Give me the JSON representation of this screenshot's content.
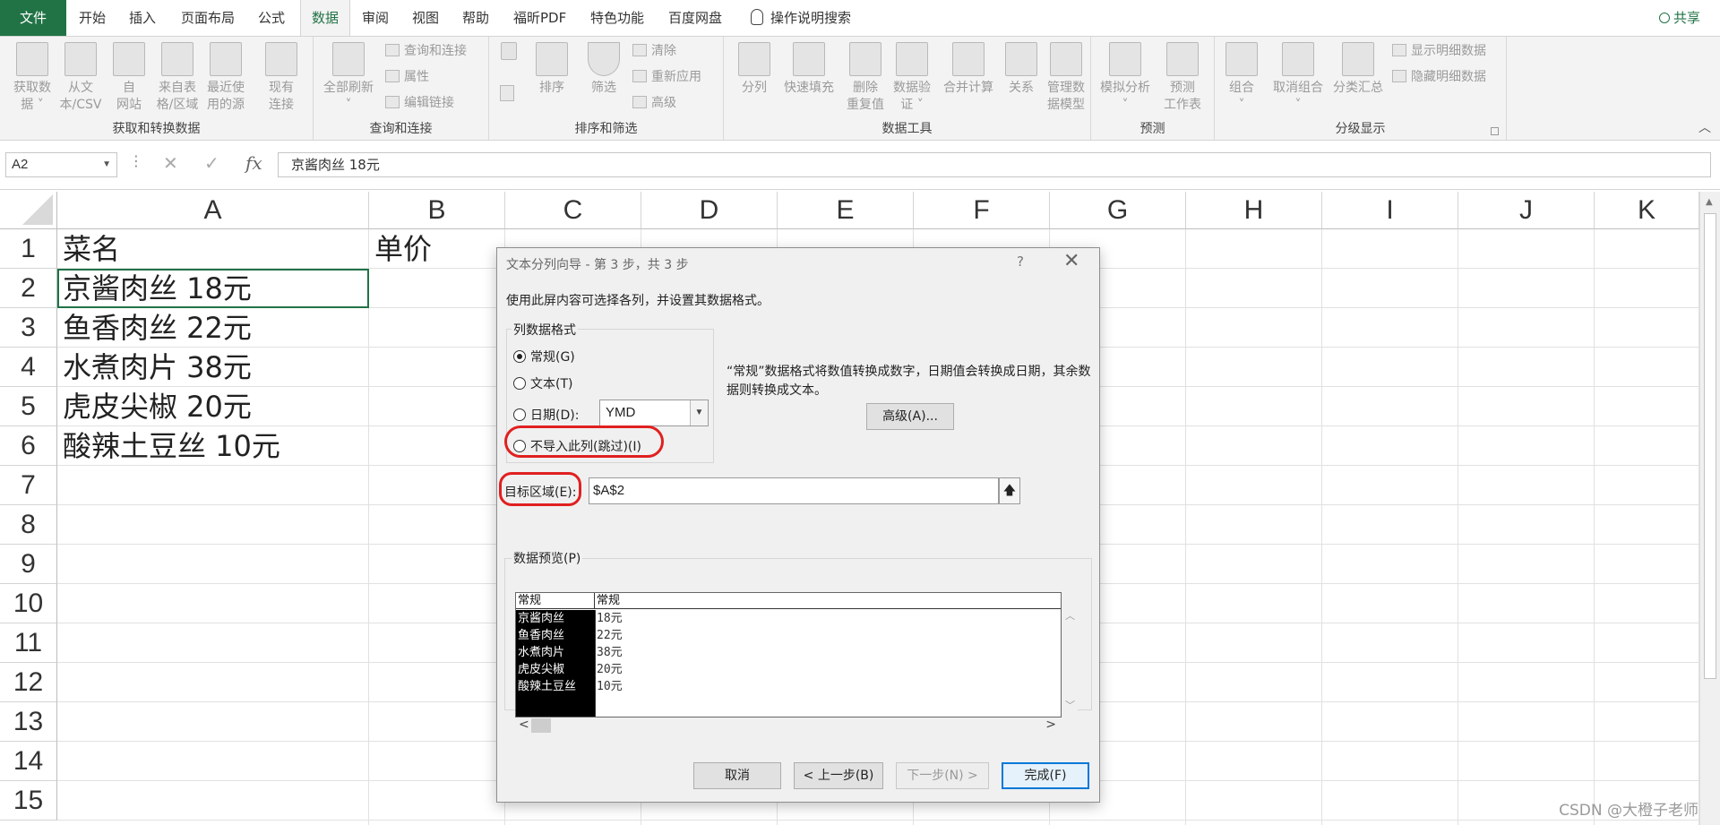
{
  "tabs": {
    "file": "文件",
    "items": [
      "开始",
      "插入",
      "页面布局",
      "公式",
      "数据",
      "审阅",
      "视图",
      "帮助",
      "福昕PDF",
      "特色功能",
      "百度网盘"
    ],
    "active_index": 4,
    "tell_me": "操作说明搜索",
    "share": "共享"
  },
  "ribbon": {
    "get_transform": {
      "label": "获取和转换数据",
      "buttons": [
        "获取数\n据 ˅",
        "从文\n本/CSV",
        "自\n网站",
        "来自表\n格/区域",
        "最近使\n用的源",
        "现有\n连接"
      ]
    },
    "queries": {
      "label": "查询和连接",
      "refresh": "全部刷新\n˅",
      "items": [
        "查询和连接",
        "属性",
        "编辑链接"
      ]
    },
    "sort_filter": {
      "label": "排序和筛选",
      "sort": "排序",
      "filter": "筛选",
      "items": [
        "清除",
        "重新应用",
        "高级"
      ]
    },
    "data_tools": {
      "label": "数据工具",
      "buttons": [
        "分列",
        "快速填充",
        "删除\n重复值",
        "数据验\n证 ˅",
        "合并计算",
        "关系",
        "管理数\n据模型"
      ]
    },
    "forecast": {
      "label": "预测",
      "buttons": [
        "模拟分析\n˅",
        "预测\n工作表"
      ]
    },
    "outline": {
      "label": "分级显示",
      "buttons": [
        "组合\n˅",
        "取消组合\n˅",
        "分类汇总"
      ],
      "items": [
        "显示明细数据",
        "隐藏明细数据"
      ]
    }
  },
  "formula_bar": {
    "name_box": "A2",
    "fx": "fx",
    "content": "京酱肉丝 18元"
  },
  "sheet": {
    "columns": [
      "A",
      "B",
      "C",
      "D",
      "E",
      "F",
      "G",
      "H",
      "I",
      "J",
      "K"
    ],
    "rows": [
      "1",
      "2",
      "3",
      "4",
      "5",
      "6",
      "7",
      "8",
      "9",
      "10",
      "11",
      "12",
      "13",
      "14",
      "15"
    ],
    "A": [
      "菜名",
      "京酱肉丝 18元",
      "鱼香肉丝 22元",
      "水煮肉片 38元",
      "虎皮尖椒 20元",
      "酸辣土豆丝 10元"
    ],
    "B1": "单价"
  },
  "dialog": {
    "title": "文本分列向导 - 第 3 步，共 3 步",
    "help": "?",
    "description": "使用此屏内容可选择各列，并设置其数据格式。",
    "format_group": "列数据格式",
    "radio_general": "常规(G)",
    "radio_text": "文本(T)",
    "radio_date": "日期(D):",
    "date_value": "YMD",
    "radio_skip": "不导入此列(跳过)(I)",
    "selected_format": "常规",
    "general_note": "“常规”数据格式将数值转换成数字，日期值会转换成日期，其余数据则转换成文本。",
    "advanced_button": "高级(A)...",
    "target_label": "目标区域(E):",
    "target_value": "$A$2",
    "preview_label": "数据预览(P)",
    "preview_headers": [
      "常规",
      "常规"
    ],
    "preview_rows": [
      [
        "京酱肉丝",
        "18元"
      ],
      [
        "鱼香肉丝",
        "22元"
      ],
      [
        "水煮肉片",
        "38元"
      ],
      [
        "虎皮尖椒",
        "20元"
      ],
      [
        "酸辣土豆丝",
        "10元"
      ]
    ],
    "buttons": {
      "cancel": "取消",
      "back": "< 上一步(B)",
      "next": "下一步(N) >",
      "finish": "完成(F)"
    }
  },
  "watermark": "CSDN @大橙子老师",
  "colors": {
    "excel_green": "#217346",
    "annotation_red": "#e02020",
    "focus_blue": "#0078d7"
  }
}
